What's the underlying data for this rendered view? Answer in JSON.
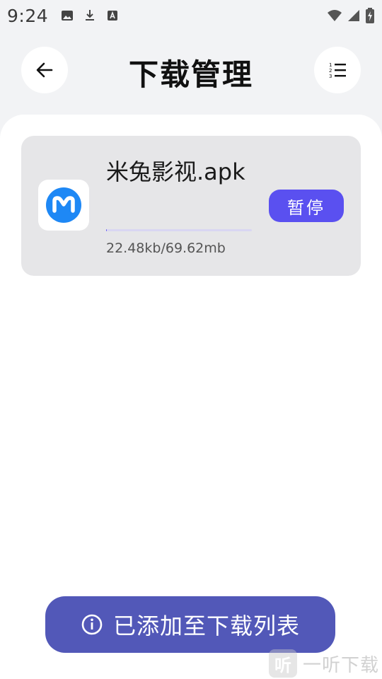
{
  "status_bar": {
    "time": "9:24",
    "icons_left": [
      "image-icon",
      "download-icon",
      "text-a-icon"
    ],
    "icons_right": [
      "wifi-icon",
      "signal-icon",
      "battery-charging-icon"
    ]
  },
  "header": {
    "title": "下载管理",
    "back_icon": "arrow-left-icon",
    "list_icon": "numbered-list-icon"
  },
  "download_item": {
    "app_icon": "mitu-app-icon",
    "file_name": "米兔影视.apk",
    "size_progress": "22.48kb/69.62mb",
    "progress": 0.0003,
    "pause_label": "暂停"
  },
  "toast": {
    "icon": "info-icon",
    "message": "已添加至下载列表"
  },
  "watermark": {
    "logo_char": "听",
    "text": "一听下载"
  },
  "colors": {
    "accent": "#5a50f0",
    "toast_bg": "#5258b8",
    "card_bg": "#e6e6e8",
    "page_bg": "#f2f3f5",
    "app_icon_blue": "#1e88f5"
  }
}
